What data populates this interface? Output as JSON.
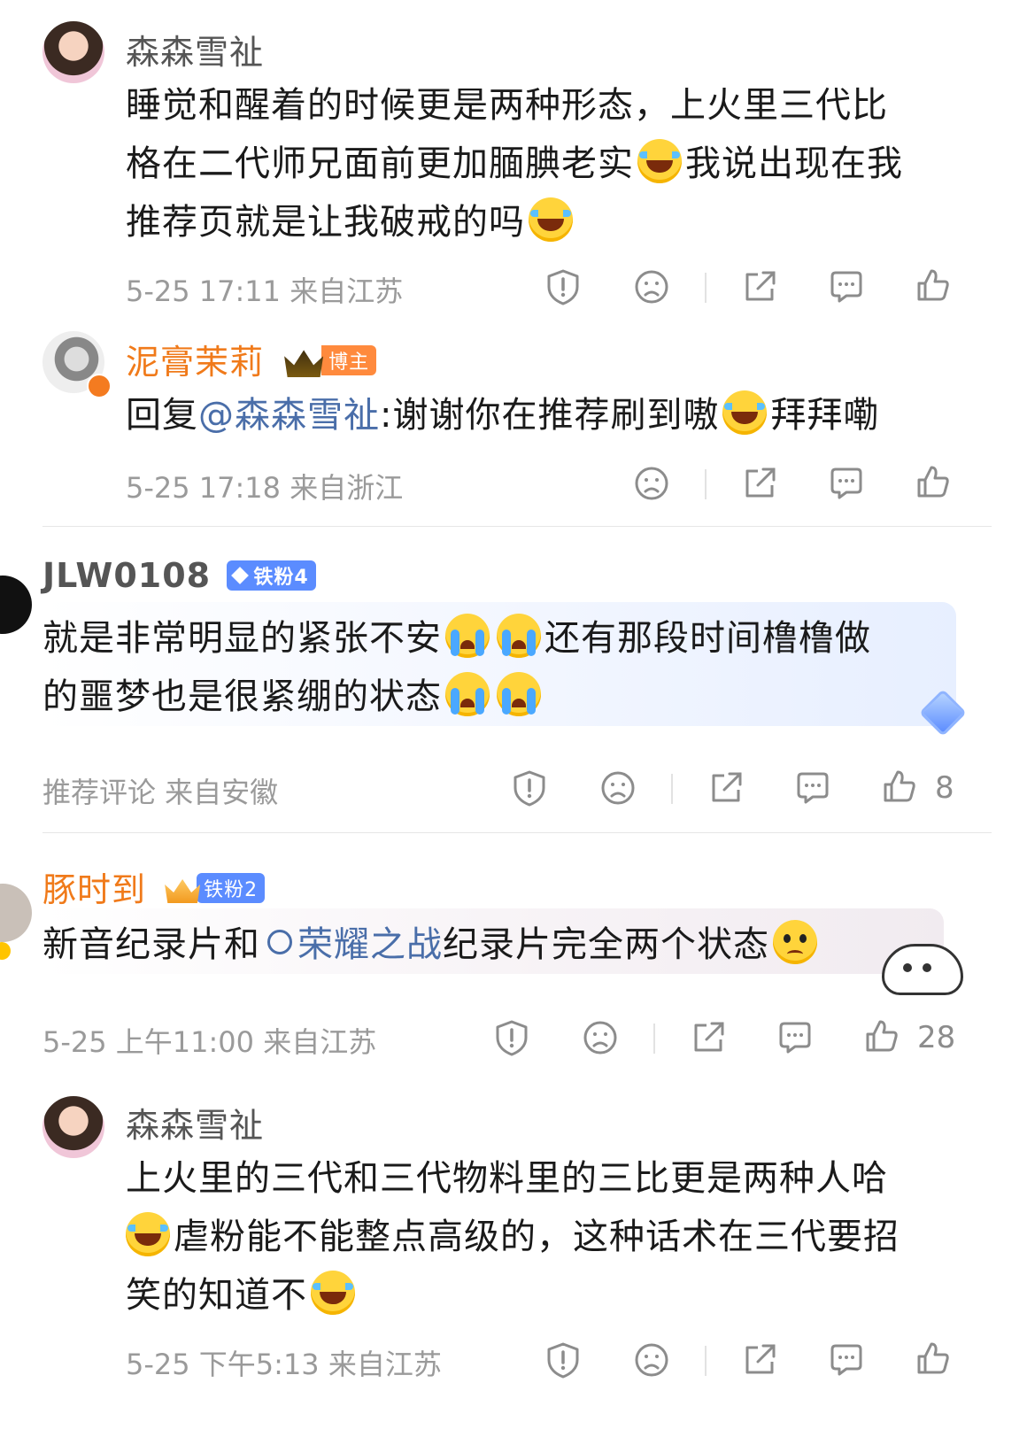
{
  "comments": [
    {
      "name": "森森雪祉",
      "text_parts": [
        "睡觉和醒着的时候更是两种形态，上火里三代比格在二代师兄面前更加腼腆老实",
        "我说出现在我推荐页就是让我破戒的吗"
      ],
      "line1": "睡觉和醒着的时候更是两种形态，上火里三代比",
      "line2a": "格在二代师兄面前更加腼腆老实",
      "line2b": "我说出现在我",
      "line3": "推荐页就是让我破戒的吗",
      "meta": "5-25 17:11 来自江苏"
    },
    {
      "name": "泥膏茉莉",
      "badge": "博主",
      "reply_prefix": "回复",
      "mention": "@森森雪祉",
      "text_a": ":谢谢你在推荐刷到嗷",
      "text_b": "拜拜嘞",
      "meta": "5-25 17:18 来自浙江"
    },
    {
      "name": "JLW0108",
      "badge": "铁粉4",
      "line1a": "就是非常明显的紧张不安",
      "line1b": "还有那段时间橹橹做",
      "line2": "的噩梦也是很紧绷的状态",
      "meta": "推荐评论 来自安徽",
      "likes": "8"
    },
    {
      "name": "豚时到",
      "badge": "铁粉2",
      "text_a": "新音纪录片和",
      "link": "荣耀之战",
      "text_b": "纪录片完全两个状态",
      "meta": "5-25 上午11:00 来自江苏",
      "likes": "28"
    },
    {
      "name": "森森雪祉",
      "line1": "上火里的三代和三代物料里的三比更是两种人哈",
      "line2": "虐粉能不能整点高级的，这种话术在三代要招",
      "line3": "笑的知道不",
      "meta": "5-25 下午5:13 来自江苏"
    }
  ],
  "icons": [
    "report-icon",
    "dislike-face-icon",
    "share-icon",
    "comment-icon",
    "like-icon"
  ],
  "colors": {
    "orange_name": "#f07a1a",
    "mention_blue": "#4a6ea9",
    "badge_blue": "#5b8cff",
    "badge_orange": "#ff8a3d"
  }
}
